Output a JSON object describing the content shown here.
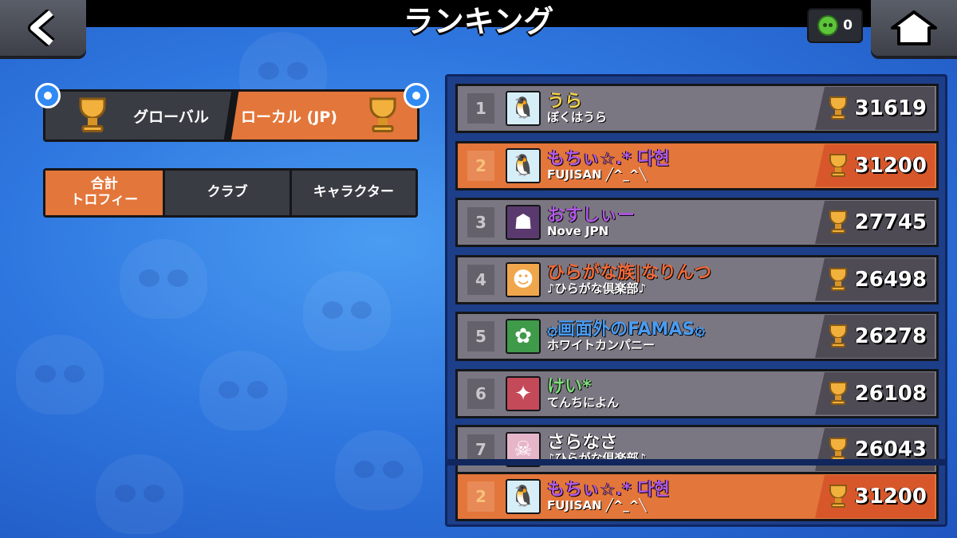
{
  "header": {
    "title": "ランキング",
    "tokens": "0"
  },
  "region_tabs": [
    {
      "label": "グローバル",
      "active": false
    },
    {
      "label": "ローカル (JP)",
      "active": true
    }
  ],
  "category_tabs": [
    {
      "label": "合計\nトロフィー",
      "active": true
    },
    {
      "label": "クラブ",
      "active": false
    },
    {
      "label": "キャラクター",
      "active": false
    }
  ],
  "rankings": [
    {
      "rank": "1",
      "name": "うら",
      "club": "ぼくはうら",
      "trophies": "31619",
      "name_color": "#f5d34a",
      "avatar": "penguin-avatar-icon"
    },
    {
      "rank": "2",
      "name": "もちぃ☆.* 다현",
      "club": "FUJISAN ╱^_^╲",
      "trophies": "31200",
      "name_color": "#b35ae8",
      "avatar": "penguin-avatar-icon"
    },
    {
      "rank": "3",
      "name": "おすしぃー",
      "club": "Nove JPN",
      "trophies": "27745",
      "name_color": "#b35ae8",
      "avatar": "dark-brawler-avatar-icon"
    },
    {
      "rank": "4",
      "name": "ひらがな族|なりんつ",
      "club": "♪ひらがな倶楽部♪",
      "trophies": "26498",
      "name_color": "#f06a3a",
      "avatar": "robot-avatar-icon"
    },
    {
      "rank": "5",
      "name": "۞画面外のFAMAS۞",
      "club": "ホワイトカンパニー",
      "trophies": "26278",
      "name_color": "#4a9cf2",
      "avatar": "leaf-brawler-avatar-icon"
    },
    {
      "rank": "6",
      "name": "けい*",
      "club": "てんちによん",
      "trophies": "26108",
      "name_color": "#7ee07a",
      "avatar": "bird-brawler-avatar-icon"
    },
    {
      "rank": "7",
      "name": "さらなさ",
      "club": "♪ひらがな倶楽部♪",
      "trophies": "26043",
      "name_color": "#ffffff",
      "avatar": "pirate-avatar-icon"
    }
  ],
  "my_rank": {
    "rank": "2",
    "name": "もちぃ☆.* 다현",
    "club": "FUJISAN ╱^_^╲",
    "trophies": "31200",
    "name_color": "#b35ae8",
    "avatar": "penguin-avatar-icon"
  },
  "colors": {
    "accent_orange": "#e3763a",
    "row_gray": "#7b7782",
    "background_blue": "#2f78e0"
  }
}
